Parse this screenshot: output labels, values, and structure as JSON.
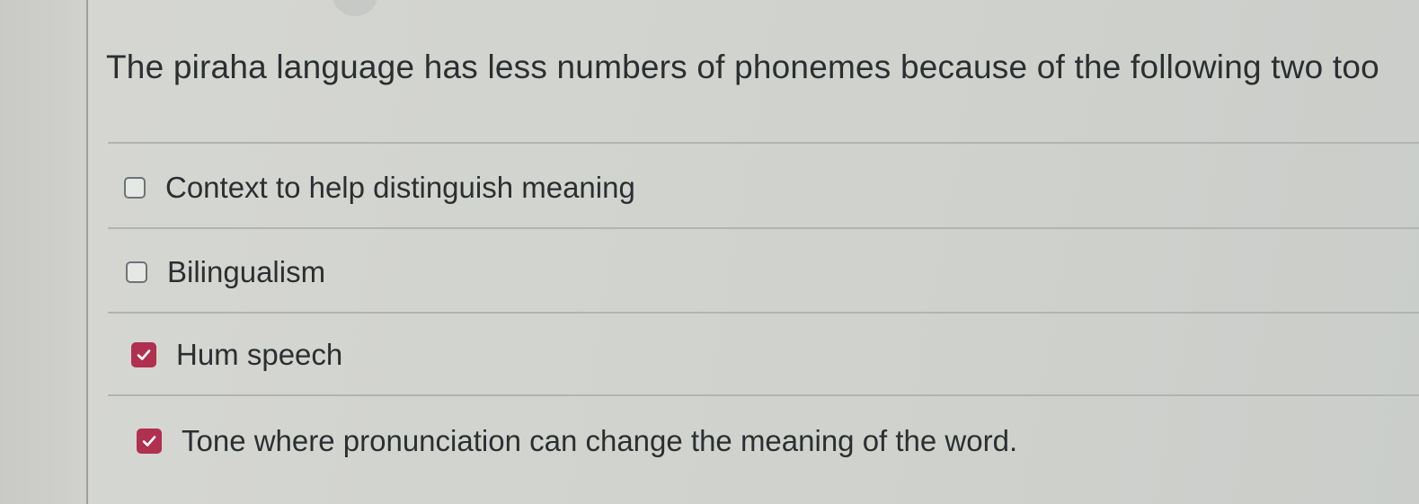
{
  "question": {
    "text": "The piraha language has less numbers of phonemes because of the following two too"
  },
  "options": [
    {
      "label": "Context to help distinguish meaning",
      "checked": false
    },
    {
      "label": "Bilingualism",
      "checked": false
    },
    {
      "label": "Hum speech",
      "checked": true
    },
    {
      "label": "Tone where pronunciation can change the meaning of the word.",
      "checked": true
    }
  ],
  "colors": {
    "checked_accent": "#b0304f",
    "text": "#2c2f31",
    "divider": "#b2b4b1"
  },
  "icons": {
    "checked": "checkmark-icon"
  }
}
